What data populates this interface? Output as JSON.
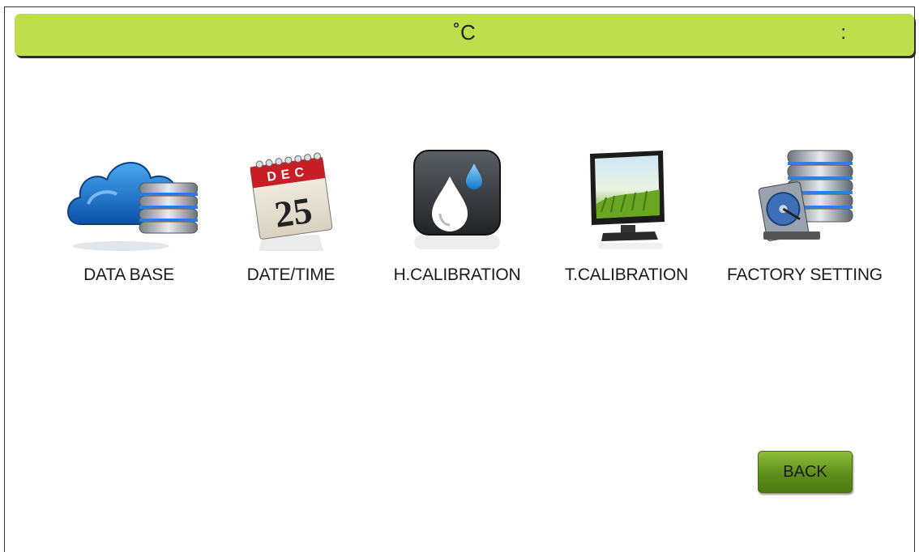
{
  "header": {
    "temperature_unit": "˚C",
    "clock_separator": ":"
  },
  "menu": [
    {
      "label": "DATA BASE",
      "icon": "cloud-database-icon"
    },
    {
      "label": "DATE/TIME",
      "icon": "calendar-icon",
      "calendar_month": "DEC",
      "calendar_day": "25"
    },
    {
      "label": "H.CALIBRATION",
      "icon": "water-drop-icon"
    },
    {
      "label": "T.CALIBRATION",
      "icon": "monitor-icon"
    },
    {
      "label": "FACTORY SETTING",
      "icon": "server-harddisk-icon"
    }
  ],
  "footer": {
    "back_label": "BACK"
  }
}
